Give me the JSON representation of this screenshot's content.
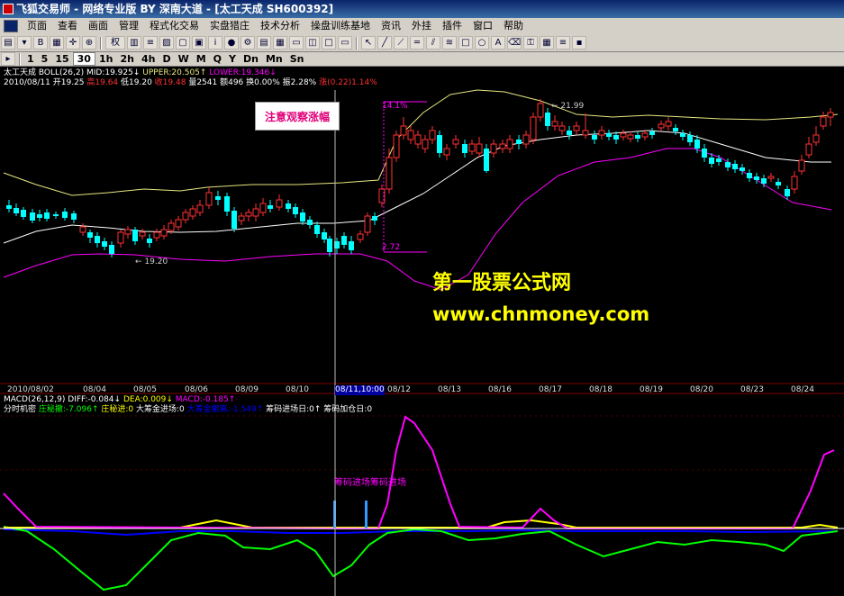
{
  "window": {
    "title": "飞狐交易师 - 网络专业版 BY 深南大道 - [太工天成 SH600392]"
  },
  "menu": [
    "页面",
    "查看",
    "画面",
    "管理",
    "程式化交易",
    "实盘猎庄",
    "技术分析",
    "操盘训练基地",
    "资讯",
    "外挂",
    "插件",
    "窗口",
    "帮助"
  ],
  "toolbar": {
    "rights_label": "权",
    "periods": [
      "1",
      "5",
      "15",
      "30",
      "1h",
      "2h",
      "4h",
      "D",
      "W",
      "M",
      "Q",
      "Y",
      "Dn",
      "Mn",
      "Sn"
    ],
    "active_period": "30"
  },
  "main_chart": {
    "indicator_line": {
      "title": "太工天成",
      "boll": "BOLL(26,2)",
      "mid": "MID:19.925",
      "upper": "UPPER:20.505",
      "lower": "LOWER:19.346"
    },
    "quote_line": {
      "date": "2010/08/11",
      "open": "开19.25",
      "high": "高19.64",
      "low": "低19.20",
      "close": "收19.48",
      "volume": "量2541",
      "amount": "额496",
      "turnover": "换0.00%",
      "amplitude": "振2.28%",
      "change": "涨(0.22)1.14%"
    },
    "price_labels": {
      "high_mark": "21.99",
      "low_mark": "19.20",
      "measure_top": "14.1%",
      "measure_bottom": "2.72"
    },
    "callout": "注意观察涨幅",
    "watermark_name": "第一股票公式网",
    "watermark_url": "www.chnmoney.com"
  },
  "x_axis": {
    "labels": [
      "2010/08/02",
      "08/04",
      "08/05",
      "08/06",
      "08/09",
      "08/10",
      "08/11,10:00",
      "08/12",
      "08/13",
      "08/16",
      "08/17",
      "08/18",
      "08/19",
      "08/20",
      "08/23",
      "08/24"
    ]
  },
  "macd_line": {
    "title": "MACD(26,12,9)",
    "diff": "DIFF:-0.084",
    "dea": "DEA:0.009",
    "macd": "MACD:-0.185"
  },
  "sub_chart": {
    "title": "分时机密",
    "items": [
      {
        "text": "庄秘撤:-7.096",
        "color": "#00ff00"
      },
      {
        "text": "庄秘进:0",
        "color": "#ffff00"
      },
      {
        "text": "大筹金进场:0",
        "color": "#ffffff"
      },
      {
        "text": "大筹金撤离:-1.549",
        "color": "#0000ff"
      },
      {
        "text": "筹码进场日:0",
        "color": "#ffffff"
      },
      {
        "text": "筹码加仓日:0",
        "color": "#ffffff"
      }
    ],
    "annotation": "筹码进场筹码进场"
  },
  "colors": {
    "up": "#ff3232",
    "down": "#00ffff",
    "mid_line": "#ffffff",
    "upper_line": "#e6e680",
    "lower_line": "#ff00ff",
    "zhuang_out": "#00ff00",
    "zhuang_in": "#ffff00",
    "chip_out": "#0000ff",
    "chip_in": "#ff00ff"
  }
}
